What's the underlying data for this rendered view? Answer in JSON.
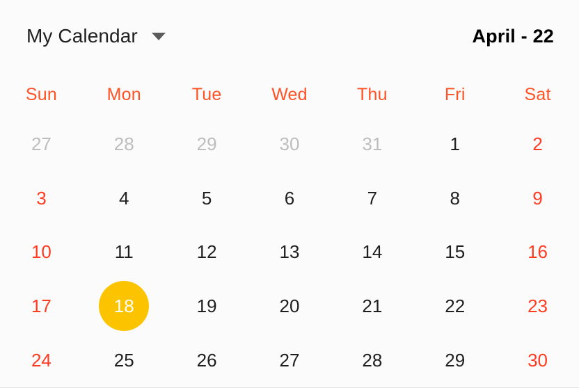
{
  "header": {
    "calendar_name": "My Calendar",
    "dropdown_icon": "chevron-down-icon",
    "month_label": "April - 22"
  },
  "colors": {
    "accent_weekday_header": "#ff5226",
    "weekend_date": "#ff3b21",
    "selected_background": "#fcc400",
    "selected_text": "#ffffff",
    "muted_date": "#bdbdbd",
    "default_date": "#1f1f1f",
    "page_background": "#fafbfa"
  },
  "weekdays": [
    {
      "label": "Sun"
    },
    {
      "label": "Mon"
    },
    {
      "label": "Tue"
    },
    {
      "label": "Wed"
    },
    {
      "label": "Thu"
    },
    {
      "label": "Fri"
    },
    {
      "label": "Sat"
    }
  ],
  "weeks": [
    [
      {
        "day": "27",
        "muted": true,
        "weekend": true,
        "selected": false
      },
      {
        "day": "28",
        "muted": true,
        "weekend": false,
        "selected": false
      },
      {
        "day": "29",
        "muted": true,
        "weekend": false,
        "selected": false
      },
      {
        "day": "30",
        "muted": true,
        "weekend": false,
        "selected": false
      },
      {
        "day": "31",
        "muted": true,
        "weekend": false,
        "selected": false
      },
      {
        "day": "1",
        "muted": false,
        "weekend": false,
        "selected": false
      },
      {
        "day": "2",
        "muted": false,
        "weekend": true,
        "selected": false
      }
    ],
    [
      {
        "day": "3",
        "muted": false,
        "weekend": true,
        "selected": false
      },
      {
        "day": "4",
        "muted": false,
        "weekend": false,
        "selected": false
      },
      {
        "day": "5",
        "muted": false,
        "weekend": false,
        "selected": false
      },
      {
        "day": "6",
        "muted": false,
        "weekend": false,
        "selected": false
      },
      {
        "day": "7",
        "muted": false,
        "weekend": false,
        "selected": false
      },
      {
        "day": "8",
        "muted": false,
        "weekend": false,
        "selected": false
      },
      {
        "day": "9",
        "muted": false,
        "weekend": true,
        "selected": false
      }
    ],
    [
      {
        "day": "10",
        "muted": false,
        "weekend": true,
        "selected": false
      },
      {
        "day": "11",
        "muted": false,
        "weekend": false,
        "selected": false
      },
      {
        "day": "12",
        "muted": false,
        "weekend": false,
        "selected": false
      },
      {
        "day": "13",
        "muted": false,
        "weekend": false,
        "selected": false
      },
      {
        "day": "14",
        "muted": false,
        "weekend": false,
        "selected": false
      },
      {
        "day": "15",
        "muted": false,
        "weekend": false,
        "selected": false
      },
      {
        "day": "16",
        "muted": false,
        "weekend": true,
        "selected": false
      }
    ],
    [
      {
        "day": "17",
        "muted": false,
        "weekend": true,
        "selected": false
      },
      {
        "day": "18",
        "muted": false,
        "weekend": false,
        "selected": true
      },
      {
        "day": "19",
        "muted": false,
        "weekend": false,
        "selected": false
      },
      {
        "day": "20",
        "muted": false,
        "weekend": false,
        "selected": false
      },
      {
        "day": "21",
        "muted": false,
        "weekend": false,
        "selected": false
      },
      {
        "day": "22",
        "muted": false,
        "weekend": false,
        "selected": false
      },
      {
        "day": "23",
        "muted": false,
        "weekend": true,
        "selected": false
      }
    ],
    [
      {
        "day": "24",
        "muted": false,
        "weekend": true,
        "selected": false
      },
      {
        "day": "25",
        "muted": false,
        "weekend": false,
        "selected": false
      },
      {
        "day": "26",
        "muted": false,
        "weekend": false,
        "selected": false
      },
      {
        "day": "27",
        "muted": false,
        "weekend": false,
        "selected": false
      },
      {
        "day": "28",
        "muted": false,
        "weekend": false,
        "selected": false
      },
      {
        "day": "29",
        "muted": false,
        "weekend": false,
        "selected": false
      },
      {
        "day": "30",
        "muted": false,
        "weekend": true,
        "selected": false
      }
    ]
  ]
}
